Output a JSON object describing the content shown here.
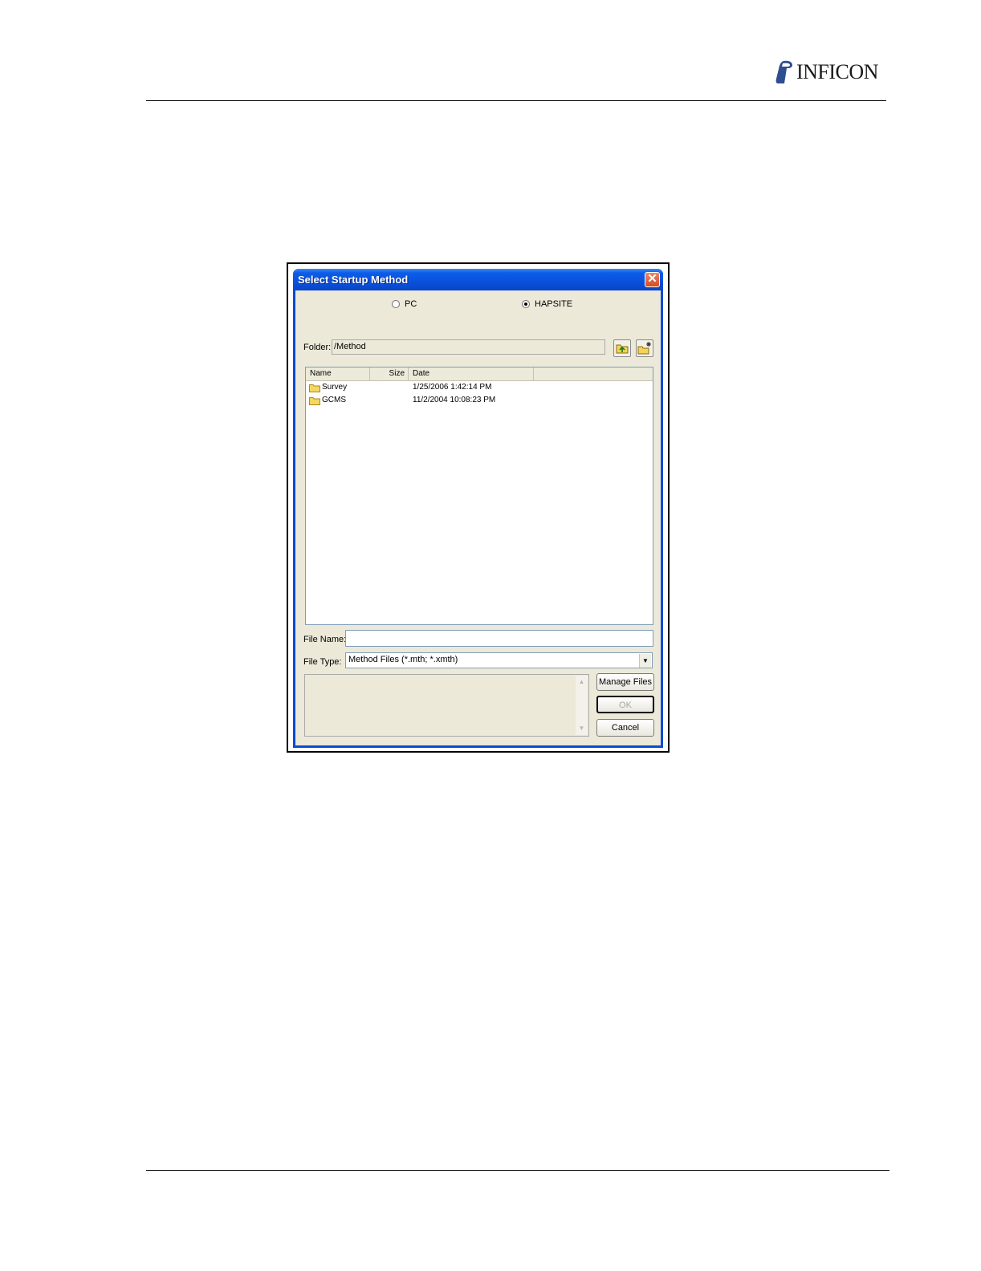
{
  "page": {
    "brand": "INFICON"
  },
  "dialog": {
    "title": "Select Startup Method",
    "close_glyph": "✕",
    "source_options": [
      {
        "label": "PC",
        "selected": false
      },
      {
        "label": "HAPSITE",
        "selected": true
      }
    ],
    "folder_label": "Folder:",
    "folder_value": "/Method",
    "toolbar": {
      "up_folder_icon": "up-folder-icon",
      "new_folder_icon": "new-folder-icon"
    },
    "list": {
      "columns": [
        "Name",
        "Size",
        "Date"
      ],
      "rows": [
        {
          "name": "Survey",
          "size": "",
          "date": "1/25/2006 1:42:14 PM"
        },
        {
          "name": "GCMS",
          "size": "",
          "date": "11/2/2004 10:08:23 PM"
        }
      ]
    },
    "file_name_label": "File Name:",
    "file_name_value": "",
    "file_type_label": "File Type:",
    "file_type_value": "Method Files (*.mth; *.xmth)",
    "buttons": {
      "manage_files": "Manage Files",
      "ok": "OK",
      "cancel": "Cancel"
    },
    "colors": {
      "titlebar": "#0a52de",
      "client": "#ece9d8",
      "close": "#d54b21"
    }
  }
}
